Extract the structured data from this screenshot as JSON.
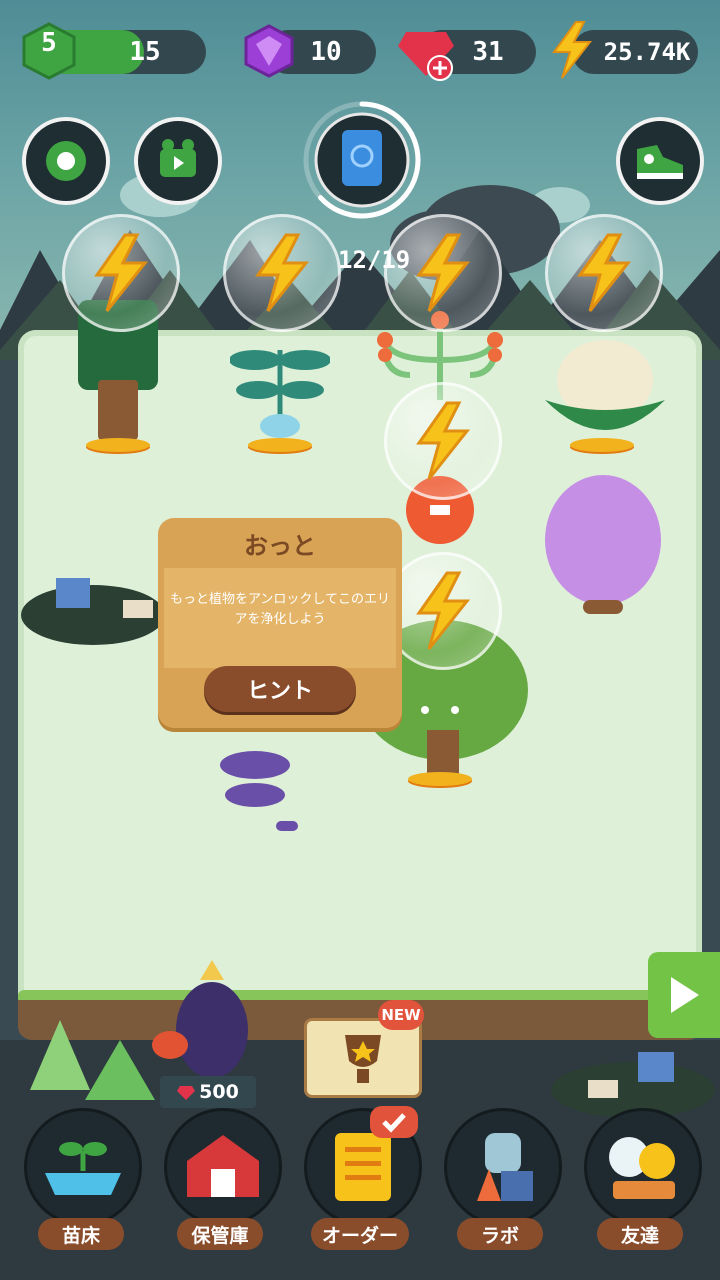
{
  "hud": {
    "level": "5",
    "xp": "15",
    "gems": "10",
    "rubies": "31",
    "energy": "25.74K"
  },
  "icons": {
    "settings": "gear-icon",
    "video": "video-camera-icon",
    "journal": "plant-journal-icon",
    "shoe": "sneaker-icon",
    "energy": "lightning-icon",
    "play": "play-icon"
  },
  "progress": {
    "text": "12/19",
    "fraction": 0.632
  },
  "tooltip": {
    "title": "おっと",
    "message": "もっと植物をアンロックしてこのエリアを浄化しよう",
    "button": "ヒント"
  },
  "shop": {
    "price": "500",
    "new_badge": "NEW"
  },
  "nav": [
    {
      "label": "苗床"
    },
    {
      "label": "保管庫"
    },
    {
      "label": "オーダー"
    },
    {
      "label": "ラボ"
    },
    {
      "label": "友達"
    }
  ],
  "colors": {
    "xp_green": "#3fa542",
    "gem_purple": "#9b3fd6",
    "ruby_red": "#e2334a",
    "energy_yellow": "#f7c21a",
    "nav_label_brown": "#8a4d2c"
  }
}
